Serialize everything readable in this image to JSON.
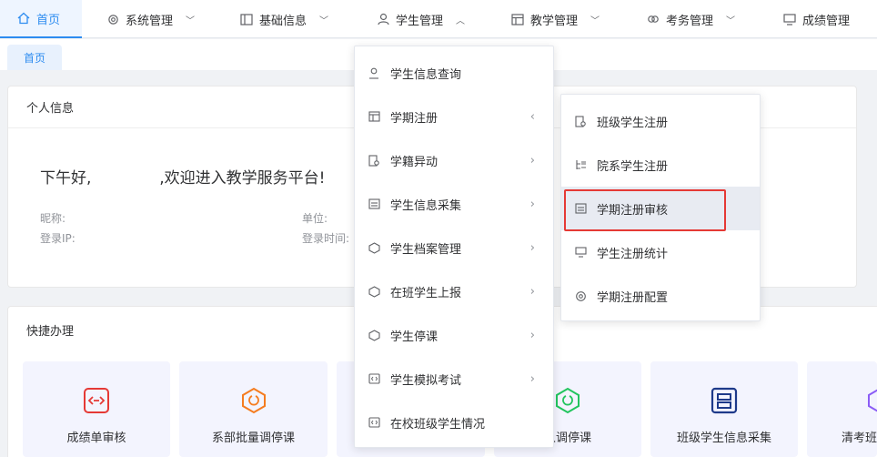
{
  "nav": {
    "items": [
      {
        "label": "首页",
        "icon": "home-icon"
      },
      {
        "label": "系统管理",
        "icon": "gear-icon"
      },
      {
        "label": "基础信息",
        "icon": "panel-icon"
      },
      {
        "label": "学生管理",
        "icon": "user-icon"
      },
      {
        "label": "教学管理",
        "icon": "table-icon"
      },
      {
        "label": "考务管理",
        "icon": "link-icon"
      },
      {
        "label": "成绩管理",
        "icon": "monitor-icon"
      }
    ]
  },
  "tabs": {
    "home": "首页"
  },
  "personal": {
    "title": "个人信息",
    "greeting_prefix": "下午好,",
    "greeting_suffix": ",欢迎进入教学服务平台!",
    "nickname_label": "昵称:",
    "unit_label": "单位:",
    "ip_label": "登录IP:",
    "time_label": "登录时间:"
  },
  "quick": {
    "title": "快捷办理",
    "items": [
      {
        "label": "成绩单审核",
        "color": "#e53935"
      },
      {
        "label": "系部批量调停课",
        "color": "#f57c1f"
      },
      {
        "label": "",
        "color": "#7c3aed"
      },
      {
        "label": "人调停课",
        "color": "#22c55e"
      },
      {
        "label": "班级学生信息采集",
        "color": "#1e3a8a"
      },
      {
        "label": "清考班",
        "color": "#8b5cf6"
      }
    ]
  },
  "student_menu": {
    "items": [
      {
        "label": "学生信息查询",
        "arrow": ""
      },
      {
        "label": "学期注册",
        "arrow": "‹"
      },
      {
        "label": "学籍异动",
        "arrow": "›"
      },
      {
        "label": "学生信息采集",
        "arrow": "›"
      },
      {
        "label": "学生档案管理",
        "arrow": "›"
      },
      {
        "label": "在班学生上报",
        "arrow": "›"
      },
      {
        "label": "学生停课",
        "arrow": "›"
      },
      {
        "label": "学生模拟考试",
        "arrow": "›"
      },
      {
        "label": "在校班级学生情况",
        "arrow": ""
      }
    ]
  },
  "register_submenu": {
    "items": [
      {
        "label": "班级学生注册"
      },
      {
        "label": "院系学生注册"
      },
      {
        "label": "学期注册审核"
      },
      {
        "label": "学生注册统计"
      },
      {
        "label": "学期注册配置"
      }
    ]
  },
  "colors": {
    "accent": "#2d8cf0",
    "highlight": "#e53935"
  }
}
